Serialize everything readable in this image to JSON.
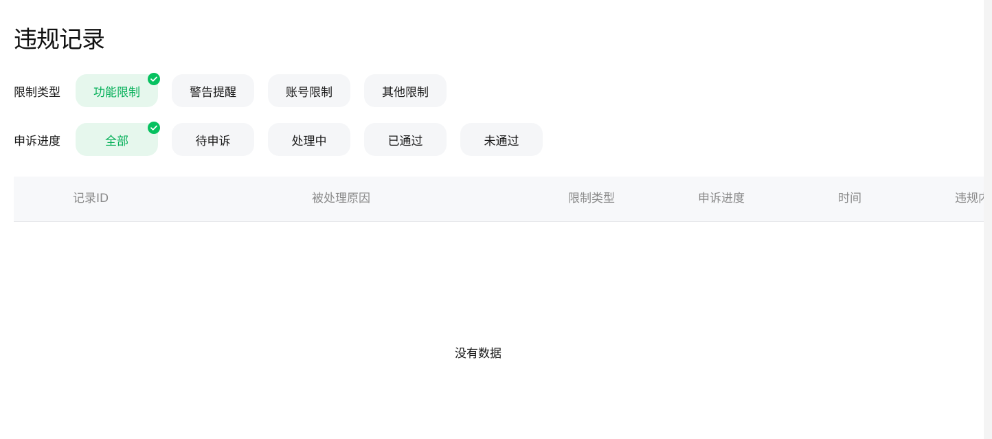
{
  "page": {
    "title": "违规记录"
  },
  "filters": {
    "type": {
      "label": "限制类型",
      "options": [
        "功能限制",
        "警告提醒",
        "账号限制",
        "其他限制"
      ],
      "selected_index": 0
    },
    "progress": {
      "label": "申诉进度",
      "options": [
        "全部",
        "待申诉",
        "处理中",
        "已通过",
        "未通过"
      ],
      "selected_index": 0
    }
  },
  "table": {
    "columns": [
      "记录ID",
      "被处理原因",
      "限制类型",
      "申诉进度",
      "时间",
      "违规内容"
    ],
    "empty_text": "没有数据"
  },
  "colors": {
    "accent": "#07c160",
    "accent_text": "#07b05a",
    "chip_active_bg": "#e6f7ed",
    "chip_bg": "#f5f6f8",
    "header_bg": "#f7f8fa"
  },
  "icons": {
    "selected": "check-circle-icon"
  }
}
